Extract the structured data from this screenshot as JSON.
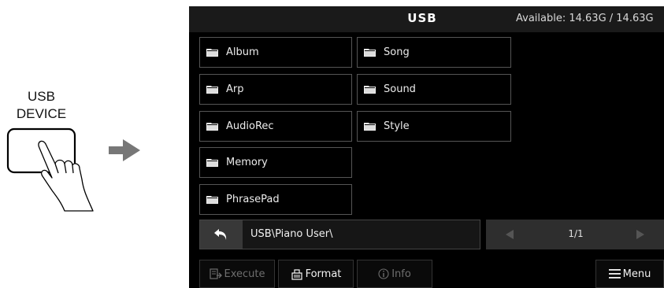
{
  "device": {
    "label_line1": "USB",
    "label_line2": "DEVICE"
  },
  "screen": {
    "title": "USB",
    "available": "Available: 14.63G / 14.63G",
    "folders": [
      {
        "label": "Album"
      },
      {
        "label": "Arp"
      },
      {
        "label": "AudioRec"
      },
      {
        "label": "Memory"
      },
      {
        "label": "PhrasePad"
      },
      {
        "label": "Song"
      },
      {
        "label": "Sound"
      },
      {
        "label": "Style"
      }
    ],
    "path": "USB\\Piano User\\",
    "page_indicator": "1/1",
    "buttons": {
      "execute": "Execute",
      "format": "Format",
      "info": "Info",
      "menu": "Menu"
    }
  },
  "icons": {
    "folder": "folder-icon",
    "back": "back-arrow-icon",
    "prev": "left-triangle-icon",
    "next": "right-triangle-icon",
    "execute": "execute-icon",
    "format": "format-icon",
    "info": "info-icon",
    "menu": "hamburger-icon",
    "finger": "finger-press-icon",
    "arrow": "right-arrow-icon"
  },
  "colors": {
    "screen_bg": "#000000",
    "titlebar_bg": "#1a1a1a",
    "button_bg": "#383838",
    "disabled_text": "#6e6e6e"
  }
}
